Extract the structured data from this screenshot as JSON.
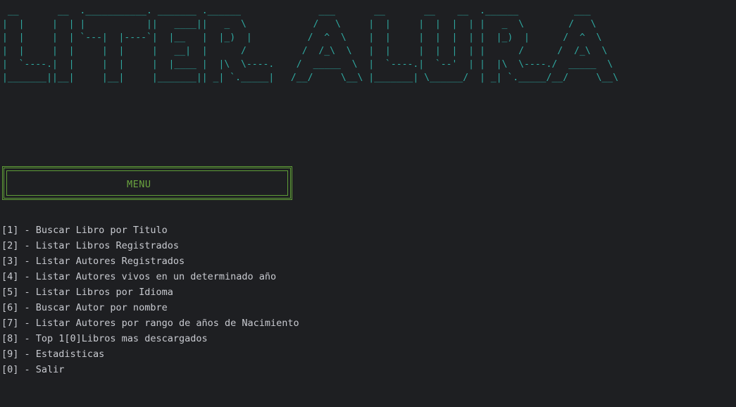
{
  "banner": {
    "lines": [
      " __       __  .___________. _______ .______              ___       __       __    __  .______          ___",
      "|  |     |  | |           ||   ____||   _  \\            /   \\     |  |     |  |  |  | |   _  \\        /   \\",
      "|  |     |  | `---|  |----`|  |__   |  |_)  |          /  ^  \\    |  |     |  |  |  | |  |_)  |      /  ^  \\",
      "|  |     |  |     |  |     |   __|  |      /          /  /_\\  \\   |  |     |  |  |  | |      /      /  /_\\  \\",
      "|  `----.|  |     |  |     |  |____ |  |\\  \\----.    /  _____  \\  |  `----.|  `--'  | |  |\\  \\----./  _____  \\",
      "|_______||__|     |__|     |_______|| _| `._____|   /__/     \\__\\ |_______| \\______/  | _| `._____/__/     \\__\\"
    ]
  },
  "menu": {
    "title": "MENU",
    "options": [
      "[1] - Buscar Libro por Titulo",
      "[2] - Listar Libros Registrados",
      "[3] - Listar Autores Registrados",
      "[4] - Listar Autores vivos en un determinado año",
      "[5] - Listar Libros por Idioma",
      "[6] - Buscar Autor por nombre",
      "[7] - Listar Autores por rango de años de Nacimiento",
      "[8] - Top 1[0]Libros mas descargados",
      "[9] - Estadisticas",
      "[0] - Salir"
    ]
  },
  "colors": {
    "background": "#1e1f22",
    "banner": "#2fa9a1",
    "menu_border": "#5f9d38",
    "menu_title": "#6aa33f",
    "text": "#c8cad0"
  }
}
